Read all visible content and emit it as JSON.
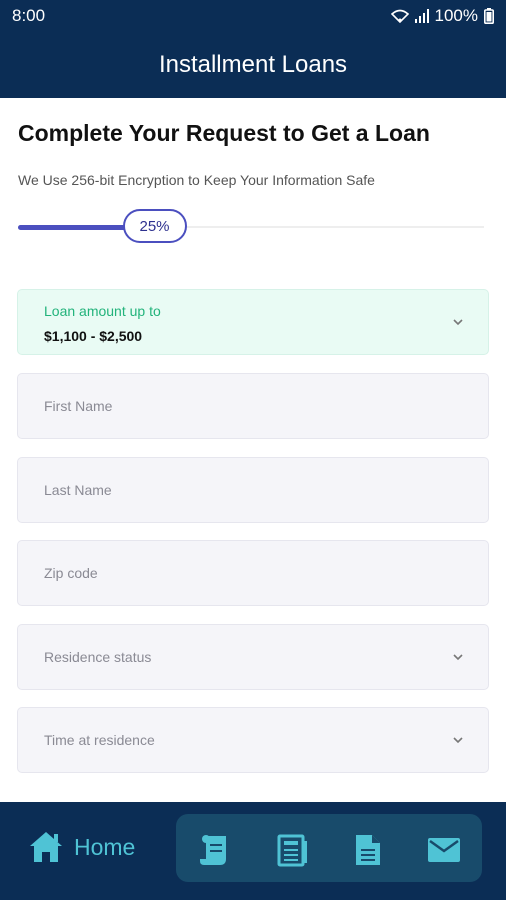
{
  "status_bar": {
    "time": "8:00",
    "battery": "100%",
    "icons": [
      "wifi-icon",
      "signal-icon",
      "battery-icon"
    ]
  },
  "app_bar": {
    "title": "Installment Loans"
  },
  "form": {
    "title": "Complete Your Request to Get a Loan",
    "subtitle": "We Use 256-bit Encryption to Keep Your Information Safe",
    "progress": {
      "label": "25%",
      "value": 0.25
    },
    "loan_amount": {
      "label": "Loan amount up to",
      "value": "$1,100 - $2,500"
    },
    "fields": {
      "first_name": "First Name",
      "last_name": "Last Name",
      "zip_code": "Zip code",
      "residence_status": "Residence status",
      "time_at_residence": "Time at residence"
    }
  },
  "bottom_nav": {
    "home_label": "Home",
    "items": [
      "home-icon",
      "scroll-icon",
      "newspaper-icon",
      "document-icon",
      "mail-icon"
    ]
  },
  "colors": {
    "primary": "#0b2d55",
    "accent": "#4b4fbf",
    "teal": "#4fc3d5",
    "success": "#22b37b"
  }
}
